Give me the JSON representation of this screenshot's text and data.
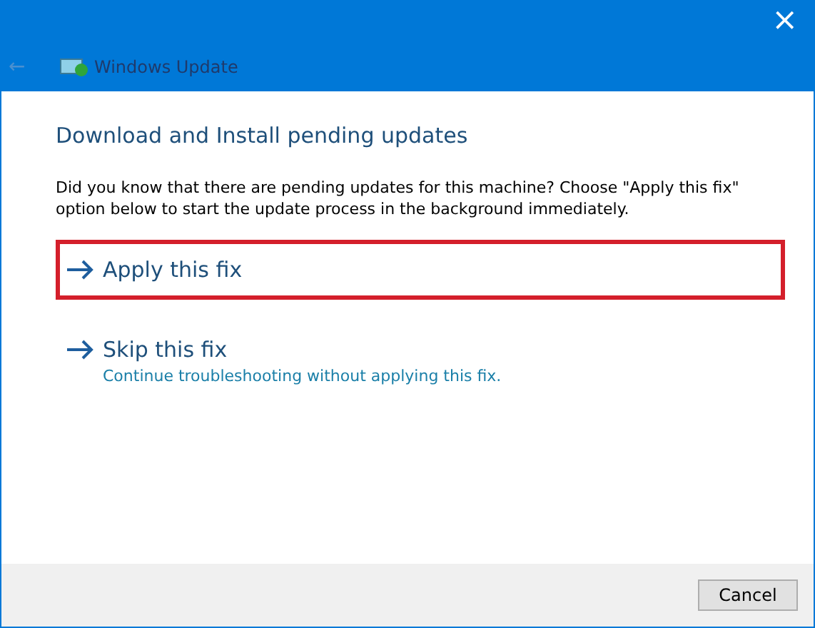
{
  "window": {
    "title": "Windows Update",
    "close": "×",
    "back": "←"
  },
  "heading": "Download and Install pending updates",
  "message": "Did you know that there are pending updates for this machine? Choose \"Apply this fix\" option below to start the update process in the background immediately.",
  "options": [
    {
      "label": "Apply this fix",
      "highlighted": true
    },
    {
      "label": "Skip this fix",
      "description": "Continue troubleshooting without applying this fix.",
      "highlighted": false
    }
  ],
  "buttons": [
    "Cancel"
  ]
}
